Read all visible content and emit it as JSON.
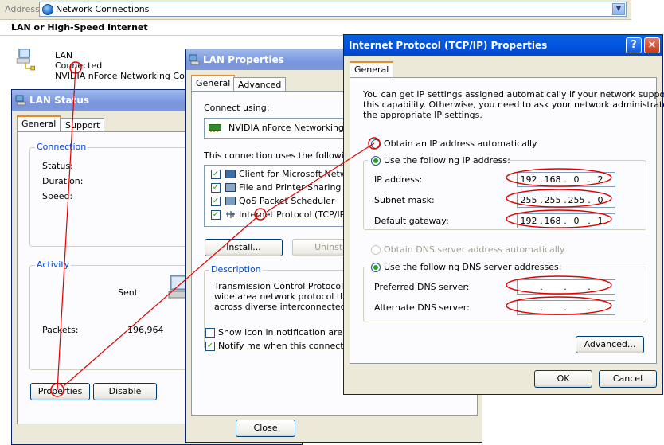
{
  "address_bar": {
    "label": "Address",
    "value": "Network Connections"
  },
  "explorer": {
    "section_title": "LAN or High-Speed Internet",
    "connection": {
      "name": "LAN",
      "status": "Connected",
      "device": "NVIDIA nForce Networking Co..."
    }
  },
  "lan_status": {
    "title": "LAN Status",
    "tabs": [
      "General",
      "Support"
    ],
    "connection_group": "Connection",
    "status_label": "Status:",
    "duration_label": "Duration:",
    "speed_label": "Speed:",
    "activity_group": "Activity",
    "sent_label": "Sent",
    "packets_label": "Packets:",
    "packets_sent": "196,964",
    "properties_button": "Properties",
    "disable_button": "Disable"
  },
  "lan_properties": {
    "title": "LAN Properties",
    "tabs": [
      "General",
      "Advanced"
    ],
    "connect_using_label": "Connect using:",
    "adapter": "NVIDIA nForce Networking Co",
    "items_label": "This connection uses the following ite",
    "items": [
      {
        "label": "Client for Microsoft Networks",
        "checked": true
      },
      {
        "label": "File and Printer Sharing for M",
        "checked": true
      },
      {
        "label": "QoS Packet Scheduler",
        "checked": true
      },
      {
        "label": "Internet Protocol (TCP/IP)",
        "checked": true
      }
    ],
    "install_button": "Install...",
    "uninstall_button": "Uninsta",
    "description_group": "Description",
    "description_lines": [
      "Transmission Control Protocol/Inte",
      "wide area network protocol that pr",
      "across diverse interconnected netw"
    ],
    "show_icon_label": "Show icon in notification area whe",
    "notify_label": "Notify me when this connection ha",
    "close_button": "Close"
  },
  "tcpip": {
    "title": "Internet Protocol (TCP/IP) Properties",
    "help_glyph": "?",
    "close_glyph": "×",
    "tab": "General",
    "intro_lines": [
      "You can get IP settings assigned automatically if your network supports",
      "this capability. Otherwise, you need to ask your network administrator for",
      "the appropriate IP settings."
    ],
    "obtain_ip_auto": "Obtain an IP address automatically",
    "use_following_ip": "Use the following IP address:",
    "ip_address_label": "IP address:",
    "ip_address": [
      "192",
      "168",
      "0",
      "2"
    ],
    "subnet_label": "Subnet mask:",
    "subnet_mask": [
      "255",
      "255",
      "255",
      "0"
    ],
    "gateway_label": "Default gateway:",
    "gateway": [
      "192",
      "168",
      "0",
      "1"
    ],
    "obtain_dns_auto": "Obtain DNS server address automatically",
    "use_following_dns": "Use the following DNS server addresses:",
    "preferred_dns_label": "Preferred DNS server:",
    "alternate_dns_label": "Alternate DNS server:",
    "advanced_button": "Advanced...",
    "ok_button": "OK",
    "cancel_button": "Cancel"
  },
  "colors": {
    "title_active": "#0054e3",
    "title_inactive": "#7a96df",
    "annotation": "#e00000",
    "dialog_face": "#ece9d8"
  }
}
